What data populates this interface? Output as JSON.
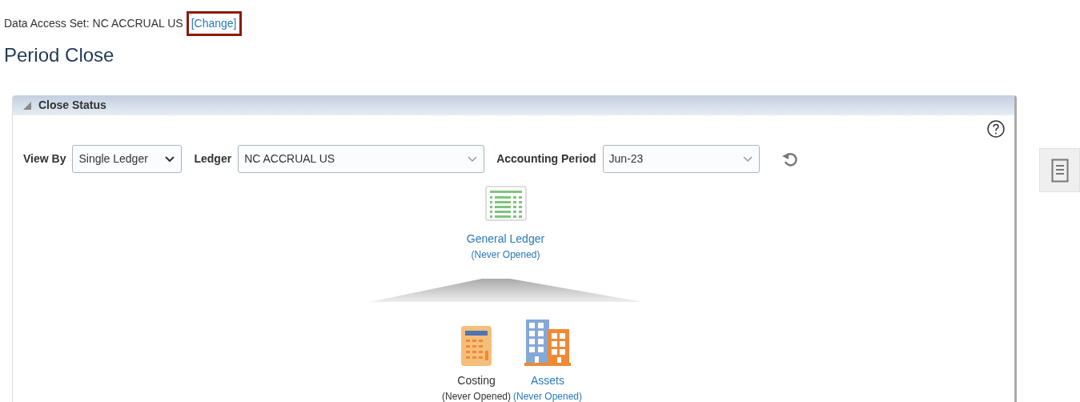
{
  "data_access_set": {
    "label": "Data Access Set:",
    "value": "NC ACCRUAL US",
    "link": "[Change]",
    "highlighted": true
  },
  "page_title": "Period Close",
  "panel": {
    "title": "Close Status",
    "expanded": true,
    "filters": [
      {
        "label": "View By",
        "value": "Single Ledger",
        "kind": "short"
      },
      {
        "label": "Ledger",
        "value": "NC ACCRUAL US",
        "kind": "wide"
      },
      {
        "label": "Accounting Period",
        "value": "Jun-23",
        "kind": "medium"
      }
    ],
    "root": {
      "kind": "ledger",
      "name": "General Ledger",
      "status": "(Never Opened)",
      "linked": true
    },
    "modules": [
      {
        "kind": "calculator",
        "name": "Costing",
        "status": "(Never Opened)",
        "linked": false
      },
      {
        "kind": "buildings",
        "name": "Assets",
        "status": "(Never Opened)",
        "linked": true
      }
    ]
  }
}
